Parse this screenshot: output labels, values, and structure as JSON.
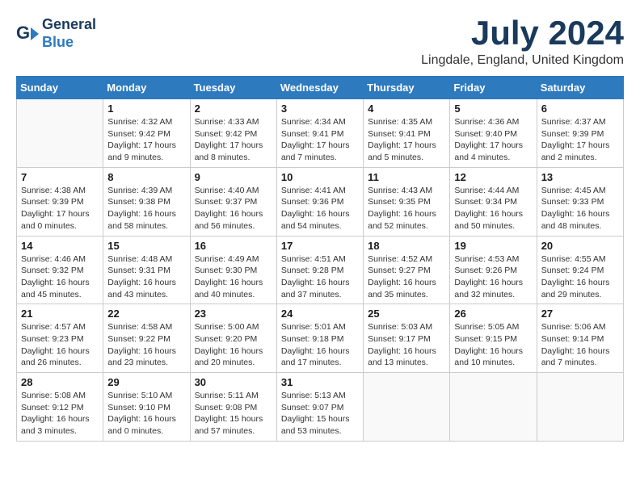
{
  "header": {
    "logo_line1": "General",
    "logo_line2": "Blue",
    "month_title": "July 2024",
    "location": "Lingdale, England, United Kingdom"
  },
  "days_of_week": [
    "Sunday",
    "Monday",
    "Tuesday",
    "Wednesday",
    "Thursday",
    "Friday",
    "Saturday"
  ],
  "weeks": [
    [
      {
        "day": "",
        "info": ""
      },
      {
        "day": "1",
        "info": "Sunrise: 4:32 AM\nSunset: 9:42 PM\nDaylight: 17 hours\nand 9 minutes."
      },
      {
        "day": "2",
        "info": "Sunrise: 4:33 AM\nSunset: 9:42 PM\nDaylight: 17 hours\nand 8 minutes."
      },
      {
        "day": "3",
        "info": "Sunrise: 4:34 AM\nSunset: 9:41 PM\nDaylight: 17 hours\nand 7 minutes."
      },
      {
        "day": "4",
        "info": "Sunrise: 4:35 AM\nSunset: 9:41 PM\nDaylight: 17 hours\nand 5 minutes."
      },
      {
        "day": "5",
        "info": "Sunrise: 4:36 AM\nSunset: 9:40 PM\nDaylight: 17 hours\nand 4 minutes."
      },
      {
        "day": "6",
        "info": "Sunrise: 4:37 AM\nSunset: 9:39 PM\nDaylight: 17 hours\nand 2 minutes."
      }
    ],
    [
      {
        "day": "7",
        "info": "Sunrise: 4:38 AM\nSunset: 9:39 PM\nDaylight: 17 hours\nand 0 minutes."
      },
      {
        "day": "8",
        "info": "Sunrise: 4:39 AM\nSunset: 9:38 PM\nDaylight: 16 hours\nand 58 minutes."
      },
      {
        "day": "9",
        "info": "Sunrise: 4:40 AM\nSunset: 9:37 PM\nDaylight: 16 hours\nand 56 minutes."
      },
      {
        "day": "10",
        "info": "Sunrise: 4:41 AM\nSunset: 9:36 PM\nDaylight: 16 hours\nand 54 minutes."
      },
      {
        "day": "11",
        "info": "Sunrise: 4:43 AM\nSunset: 9:35 PM\nDaylight: 16 hours\nand 52 minutes."
      },
      {
        "day": "12",
        "info": "Sunrise: 4:44 AM\nSunset: 9:34 PM\nDaylight: 16 hours\nand 50 minutes."
      },
      {
        "day": "13",
        "info": "Sunrise: 4:45 AM\nSunset: 9:33 PM\nDaylight: 16 hours\nand 48 minutes."
      }
    ],
    [
      {
        "day": "14",
        "info": "Sunrise: 4:46 AM\nSunset: 9:32 PM\nDaylight: 16 hours\nand 45 minutes."
      },
      {
        "day": "15",
        "info": "Sunrise: 4:48 AM\nSunset: 9:31 PM\nDaylight: 16 hours\nand 43 minutes."
      },
      {
        "day": "16",
        "info": "Sunrise: 4:49 AM\nSunset: 9:30 PM\nDaylight: 16 hours\nand 40 minutes."
      },
      {
        "day": "17",
        "info": "Sunrise: 4:51 AM\nSunset: 9:28 PM\nDaylight: 16 hours\nand 37 minutes."
      },
      {
        "day": "18",
        "info": "Sunrise: 4:52 AM\nSunset: 9:27 PM\nDaylight: 16 hours\nand 35 minutes."
      },
      {
        "day": "19",
        "info": "Sunrise: 4:53 AM\nSunset: 9:26 PM\nDaylight: 16 hours\nand 32 minutes."
      },
      {
        "day": "20",
        "info": "Sunrise: 4:55 AM\nSunset: 9:24 PM\nDaylight: 16 hours\nand 29 minutes."
      }
    ],
    [
      {
        "day": "21",
        "info": "Sunrise: 4:57 AM\nSunset: 9:23 PM\nDaylight: 16 hours\nand 26 minutes."
      },
      {
        "day": "22",
        "info": "Sunrise: 4:58 AM\nSunset: 9:22 PM\nDaylight: 16 hours\nand 23 minutes."
      },
      {
        "day": "23",
        "info": "Sunrise: 5:00 AM\nSunset: 9:20 PM\nDaylight: 16 hours\nand 20 minutes."
      },
      {
        "day": "24",
        "info": "Sunrise: 5:01 AM\nSunset: 9:18 PM\nDaylight: 16 hours\nand 17 minutes."
      },
      {
        "day": "25",
        "info": "Sunrise: 5:03 AM\nSunset: 9:17 PM\nDaylight: 16 hours\nand 13 minutes."
      },
      {
        "day": "26",
        "info": "Sunrise: 5:05 AM\nSunset: 9:15 PM\nDaylight: 16 hours\nand 10 minutes."
      },
      {
        "day": "27",
        "info": "Sunrise: 5:06 AM\nSunset: 9:14 PM\nDaylight: 16 hours\nand 7 minutes."
      }
    ],
    [
      {
        "day": "28",
        "info": "Sunrise: 5:08 AM\nSunset: 9:12 PM\nDaylight: 16 hours\nand 3 minutes."
      },
      {
        "day": "29",
        "info": "Sunrise: 5:10 AM\nSunset: 9:10 PM\nDaylight: 16 hours\nand 0 minutes."
      },
      {
        "day": "30",
        "info": "Sunrise: 5:11 AM\nSunset: 9:08 PM\nDaylight: 15 hours\nand 57 minutes."
      },
      {
        "day": "31",
        "info": "Sunrise: 5:13 AM\nSunset: 9:07 PM\nDaylight: 15 hours\nand 53 minutes."
      },
      {
        "day": "",
        "info": ""
      },
      {
        "day": "",
        "info": ""
      },
      {
        "day": "",
        "info": ""
      }
    ]
  ]
}
